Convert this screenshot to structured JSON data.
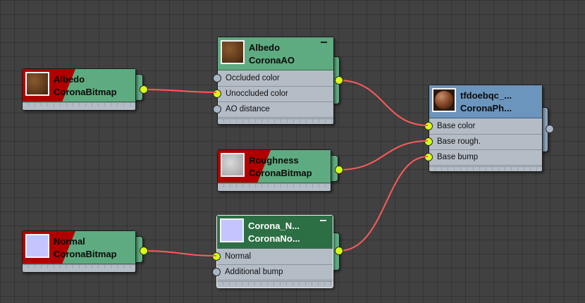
{
  "colors": {
    "background": "#414141",
    "header_green": "#5fab81",
    "header_dark_green": "#2d6f45",
    "header_blue": "#6c95bd",
    "wire": "#ff5a5a",
    "port_connected": "#d6ff14",
    "port_open": "#a8b6c8",
    "missing_red": "#b00000"
  },
  "nodes": {
    "albedo_bitmap": {
      "title": "Albedo",
      "subtitle": "CoronaBitmap",
      "thumbnail": "brown-texture"
    },
    "albedo_ao": {
      "title": "Albedo",
      "subtitle": "CoronaAO",
      "thumbnail": "brown-texture",
      "inputs": [
        "Occluded color",
        "Unoccluded color",
        "AO distance"
      ]
    },
    "physical_material": {
      "title": "tfdoebqc_...",
      "subtitle": "CoronaPh...",
      "thumbnail": "material-sphere",
      "inputs": [
        "Base color",
        "Base rough.",
        "Base bump"
      ]
    },
    "roughness_bitmap": {
      "title": "Roughness",
      "subtitle": "CoronaBitmap",
      "thumbnail": "grey-noise"
    },
    "normal_bitmap": {
      "title": "Normal",
      "subtitle": "CoronaBitmap",
      "thumbnail": "lavender-flat"
    },
    "corona_normal": {
      "title": "Corona_N...",
      "subtitle": "CoronaNo...",
      "thumbnail": "lavender-flat",
      "inputs": [
        "Normal",
        "Additional bump"
      ]
    }
  }
}
